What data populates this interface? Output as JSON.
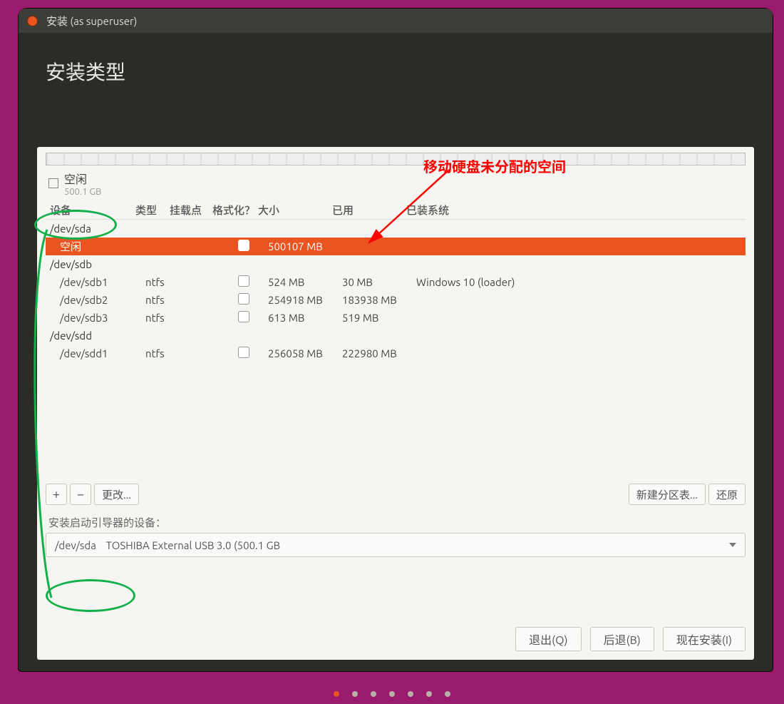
{
  "window": {
    "title": "安装 (as superuser)"
  },
  "heading": "安装类型",
  "legend": {
    "label": "空闲",
    "size": "500.1 GB"
  },
  "columns": {
    "device": "设备",
    "type": "类型",
    "mount": "挂载点",
    "format": "格式化？",
    "size": "大小",
    "used": "已用",
    "system": "已装系统"
  },
  "rows": [
    {
      "kind": "disk",
      "device": "/dev/sda"
    },
    {
      "kind": "sel",
      "device": "空闲",
      "size": "500107 MB"
    },
    {
      "kind": "disk",
      "device": "/dev/sdb"
    },
    {
      "kind": "part",
      "device": "/dev/sdb1",
      "fs": "ntfs",
      "size": "524 MB",
      "used": "30 MB",
      "system": "Windows 10 (loader)"
    },
    {
      "kind": "part",
      "device": "/dev/sdb2",
      "fs": "ntfs",
      "size": "254918 MB",
      "used": "183938 MB",
      "system": ""
    },
    {
      "kind": "part",
      "device": "/dev/sdb3",
      "fs": "ntfs",
      "size": "613 MB",
      "used": "519 MB",
      "system": ""
    },
    {
      "kind": "disk",
      "device": "/dev/sdd"
    },
    {
      "kind": "part",
      "device": "/dev/sdd1",
      "fs": "ntfs",
      "size": "256058 MB",
      "used": "222980 MB",
      "system": ""
    }
  ],
  "toolbar": {
    "add": "+",
    "remove": "−",
    "change": "更改...",
    "newtable": "新建分区表...",
    "revert": "还原"
  },
  "bootloader": {
    "label": "安装启动引导器的设备：",
    "device": "/dev/sda",
    "desc": "TOSHIBA External USB 3.0 (500.1 GB"
  },
  "footer": {
    "quit": "退出(Q)",
    "back": "后退(B)",
    "install": "现在安装(I)"
  },
  "annotations": {
    "arrow_label": "移动硬盘未分配的空间"
  },
  "pager": {
    "count": 7,
    "active": 0
  }
}
